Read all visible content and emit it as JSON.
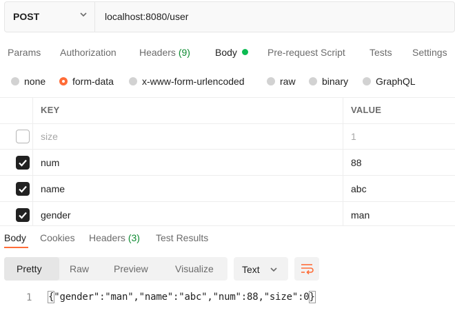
{
  "url_bar": {
    "method": "POST",
    "url": "localhost:8080/user"
  },
  "request_tabs": [
    {
      "label": "Params"
    },
    {
      "label": "Authorization"
    },
    {
      "label": "Headers",
      "count": "(9)"
    },
    {
      "label": "Body",
      "active": true,
      "indicator_color": "#0cbb52"
    },
    {
      "label": "Pre-request Script"
    },
    {
      "label": "Tests"
    },
    {
      "label": "Settings"
    }
  ],
  "body_types": [
    {
      "label": "none",
      "selected": false
    },
    {
      "label": "form-data",
      "selected": true
    },
    {
      "label": "x-www-form-urlencoded",
      "selected": false
    },
    {
      "label": "raw",
      "selected": false
    },
    {
      "label": "binary",
      "selected": false
    },
    {
      "label": "GraphQL",
      "selected": false
    }
  ],
  "params_table": {
    "headers": {
      "key": "KEY",
      "value": "VALUE"
    },
    "rows": [
      {
        "checked": false,
        "key": "size",
        "value": "1"
      },
      {
        "checked": true,
        "key": "num",
        "value": "88"
      },
      {
        "checked": true,
        "key": "name",
        "value": "abc"
      },
      {
        "checked": true,
        "key": "gender",
        "value": "man"
      }
    ]
  },
  "response_tabs": [
    {
      "label": "Body",
      "active": true
    },
    {
      "label": "Cookies"
    },
    {
      "label": "Headers",
      "count": "(3)"
    },
    {
      "label": "Test Results"
    }
  ],
  "view_modes": [
    {
      "label": "Pretty",
      "active": true
    },
    {
      "label": "Raw"
    },
    {
      "label": "Preview"
    },
    {
      "label": "Visualize"
    }
  ],
  "format_select": "Text",
  "response_body": {
    "line_number": "1",
    "open_brace": "{",
    "content": "\"gender\":\"man\",\"name\":\"abc\",\"num\":88,\"size\":0",
    "close_brace": "}"
  },
  "colors": {
    "accent": "#ff6c37",
    "status_green": "#0cbb52"
  }
}
